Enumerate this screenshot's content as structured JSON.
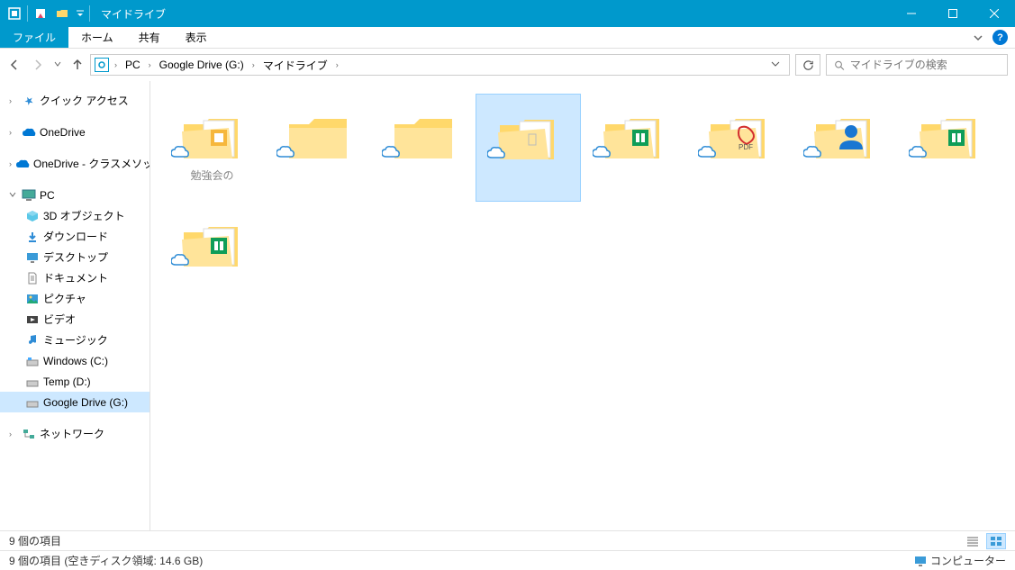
{
  "title": "マイドライブ",
  "ribbon": {
    "file": "ファイル",
    "home": "ホーム",
    "share": "共有",
    "view": "表示"
  },
  "breadcrumb": [
    "PC",
    "Google Drive (G:)",
    "マイドライブ"
  ],
  "search": {
    "placeholder": "マイドライブの検索"
  },
  "sidebar": {
    "quick_access": "クイック アクセス",
    "onedrive": "OneDrive",
    "onedrive_class": "OneDrive - クラスメソッド",
    "pc": "PC",
    "pc_children": {
      "objects3d": "3D オブジェクト",
      "downloads": "ダウンロード",
      "desktop": "デスクトップ",
      "documents": "ドキュメント",
      "pictures": "ピクチャ",
      "videos": "ビデオ",
      "music": "ミュージック",
      "windows_c": "Windows (C:)",
      "temp_d": "Temp (D:)",
      "google_g": "Google Drive (G:)"
    },
    "network": "ネットワーク"
  },
  "items": [
    {
      "label": "勉強会の",
      "overlay": "slides"
    },
    {
      "label": "",
      "overlay": "none"
    },
    {
      "label": "",
      "overlay": "none"
    },
    {
      "label": "",
      "overlay": "empty"
    },
    {
      "label": "",
      "overlay": "sheets"
    },
    {
      "label": "",
      "overlay": "pdf"
    },
    {
      "label": "",
      "overlay": "person"
    },
    {
      "label": "",
      "overlay": "sheets"
    },
    {
      "label": "",
      "overlay": "sheets"
    }
  ],
  "status": {
    "count_short": "9 個の項目",
    "count_long": "9 個の項目 (空きディスク領域: 14.6 GB)",
    "location": "コンピューター"
  }
}
